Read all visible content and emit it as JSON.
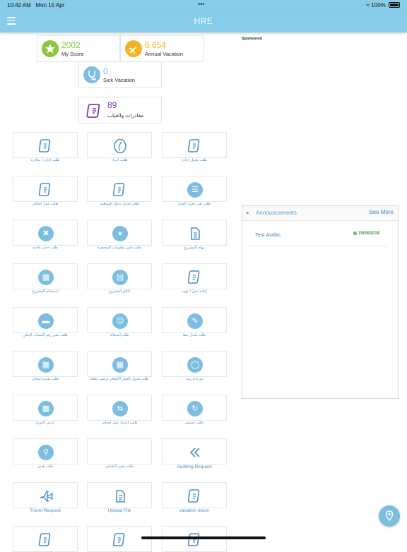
{
  "status": {
    "time": "10:42 AM",
    "date": "Mon 15 Apr",
    "dots": "•••",
    "battery": "100%"
  },
  "header": {
    "title": "HRE"
  },
  "sponsored": "Sponsored",
  "stats": {
    "score": {
      "value": "2002",
      "label": "My Score"
    },
    "annual": {
      "value": "6.654",
      "label": "Annual Vacation"
    },
    "sick": {
      "value": "0",
      "label": "Sick Vacation"
    },
    "absence": {
      "value": "89",
      "label": "مغادرات والغياب"
    }
  },
  "tiles": [
    {
      "label": "طلب إجازة / مغادرة"
    },
    {
      "label": "طلب إجراء"
    },
    {
      "label": "طلب تعديل إجازة"
    },
    {
      "label": "طلب عمل اضافي"
    },
    {
      "label": "طلب تعديل دخول الموظف"
    },
    {
      "label": "طلب تغير جدول العمل"
    },
    {
      "label": "طلب حذف إجازة"
    },
    {
      "label": "طلب تغيير معلومات الشخصية"
    },
    {
      "label": "مهام المشروع"
    },
    {
      "label": "استخدام المشروع"
    },
    {
      "label": "اغلاق المشروع"
    },
    {
      "label": "إعادة اصل / عهده"
    },
    {
      "label": "طلب تغيير رقم الحساب البنكي"
    },
    {
      "label": "طلب إستقالة"
    },
    {
      "label": "طلب تعديل خط"
    },
    {
      "label": "طلب تقديم امتحان"
    },
    {
      "label": "طلب تحويل العمل الإضافي لرصيد عطلة"
    },
    {
      "label": "دورة تدريبية"
    },
    {
      "label": "عرض الدورة"
    },
    {
      "label": "طلب إعتماد عمل اضافي"
    },
    {
      "label": "طلب تعويض"
    },
    {
      "label": "طلب هدف"
    },
    {
      "label": "طلب تقييم الاهداف"
    },
    {
      "label": "Auditing Request"
    },
    {
      "label": "Travel Request"
    },
    {
      "label": "Upload File"
    },
    {
      "label": "vacation return"
    },
    {
      "label": ""
    },
    {
      "label": ""
    },
    {
      "label": ""
    }
  ],
  "announcements": {
    "title": "Announcements",
    "see_more": "See More",
    "items": [
      {
        "title": "Test Arabic",
        "date": "15/08/2019"
      }
    ]
  },
  "colors": {
    "header": "#87CCE8",
    "accent": "#7cbde0",
    "score": "#8DC63F",
    "annual": "#F5B223",
    "absence": "#7a3cb0",
    "date": "#3a9a3a"
  }
}
